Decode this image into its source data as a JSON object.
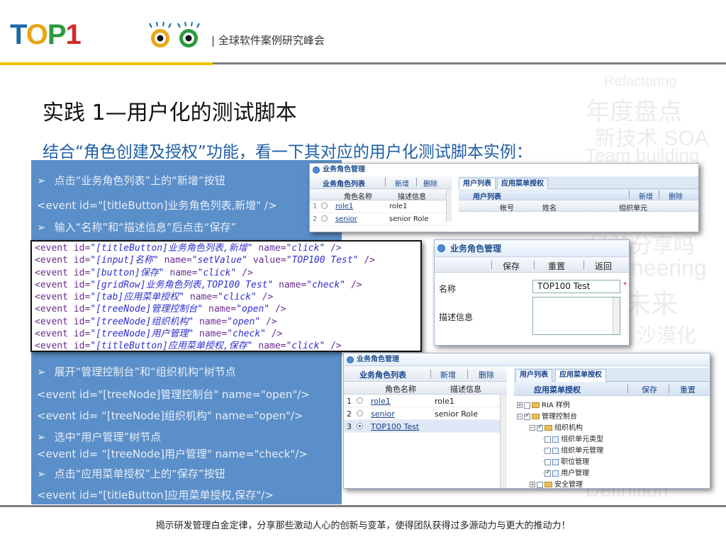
{
  "header": {
    "logo_text": [
      "T",
      "O",
      "P",
      "1"
    ],
    "subtitle": "| 全球软件案例研究峰会"
  },
  "watermark": {
    "lines": [
      "Refactoring",
      "年度盘点",
      "新技术 SOA",
      "Team building",
      "经验分享吗",
      "neering",
      "未来",
      "沙漠化",
      "Definition"
    ]
  },
  "title": "实践 1—用户化的测试脚本",
  "lead": "结合“角色创建及授权”功能，看一下其对应的用户化测试脚本实例：",
  "left_lines": {
    "l1": "点击“业务角色列表”上的“新增”按钮",
    "l2": "<event id=\"[titleButton]业务角色列表,新增\" />",
    "l3": "输入“名称”和“描述信息”后点击“保存”",
    "l4": "展开“管理控制台”和“组织机构”树节点",
    "l5": "<event id=\"[treeNode]管理控制台\" name=\"open\"/>",
    "l6": "<event id= “[treeNode]组织机构\" name=\"open\"/>",
    "l7": "选中“用户管理”树节点",
    "l8": "<event id= “[treeNode]用户管理\" name=\"check\"/>",
    "l9": "点击“应用菜单授权”上的“保存”按钮",
    "l10": "<event id=\"[titleButton]应用菜单授权,保存\"/>",
    "arrow": "➢"
  },
  "code_lines": [
    {
      "id": "\"[titleButton]业务角色列表,新增\"",
      "name": "\"click\"",
      "value": "",
      "tail": "/>"
    },
    {
      "id": "\"[input]名称\"",
      "name": "\"setValue\"",
      "value": "\"TOP100 Test\"",
      "tail": "/>"
    },
    {
      "id": "\"[button]保存\"",
      "name": "\"click\"",
      "value": "",
      "tail": "/>"
    },
    {
      "id": "\"[gridRow]业务角色列表,TOP100 Test\"",
      "name": "\"check\"",
      "value": "",
      "tail": "/>"
    },
    {
      "id": "\"[tab]应用菜单授权\"",
      "name": "\"click\"",
      "value": "",
      "tail": "/>"
    },
    {
      "id": "\"[treeNode]管理控制台\"",
      "name": "\"open\"",
      "value": "",
      "tail": "/>"
    },
    {
      "id": "\"[treeNode]组织机构\"",
      "name": "\"open\"",
      "value": "",
      "tail": "/>"
    },
    {
      "id": "\"[treeNode]用户管理\"",
      "name": "\"check\"",
      "value": "",
      "tail": "/>"
    },
    {
      "id": "\"[titleButton]应用菜单授权,保存\"",
      "name": "\"click\"",
      "value": "",
      "tail": "/>"
    }
  ],
  "code_tokens": {
    "event": "<event",
    "id": "id=",
    "name": "name=",
    "value": "value="
  },
  "panel1": {
    "title": "业务角色管理",
    "tab_left": "业务角色列表",
    "btn_add": "新增",
    "btn_del": "删除",
    "col_name": "角色名称",
    "col_desc": "描述信息",
    "rows": [
      {
        "idx": "1",
        "name": "role1",
        "desc": "role1"
      },
      {
        "idx": "2",
        "name": "senior",
        "desc": "senior Role"
      }
    ],
    "tab_users": "用户列表",
    "tab_menu": "应用菜单授权",
    "sub_title": "用户列表",
    "sub_add": "新增",
    "sub_del": "删除",
    "col_account": "帐号",
    "col_realname": "姓名",
    "col_org": "组织单元"
  },
  "panel2": {
    "title": "业务角色管理",
    "btn_save": "保存",
    "btn_reset": "重置",
    "btn_back": "返回",
    "label_name": "名称",
    "name_value": "TOP100 Test",
    "label_desc": "描述信息"
  },
  "panel3": {
    "title": "业务角色管理",
    "tab_left": "业务角色列表",
    "btn_add": "新增",
    "btn_del": "删除",
    "col_name": "角色名称",
    "col_desc": "描述信息",
    "rows": [
      {
        "idx": "1",
        "name": "role1",
        "desc": "role1"
      },
      {
        "idx": "2",
        "name": "senior",
        "desc": "senior Role"
      },
      {
        "idx": "3",
        "name": "TOP100 Test",
        "desc": ""
      }
    ],
    "tab_users": "用户列表",
    "tab_menu": "应用菜单授权",
    "menu_title": "应用菜单授权",
    "btn_save": "保存",
    "btn_reset": "重置",
    "tree": {
      "n1": "RIA 样例",
      "n2": "管理控制台",
      "n3": "组织机构",
      "n4": "组织单元类型",
      "n5": "组织单元管理",
      "n6": "职位管理",
      "n7": "用户管理",
      "n8": "安全管理"
    }
  },
  "footer": "揭示研发管理白金定律，分享那些激动人心的创新与变革，使得团队获得过多源动力与更大的推动力！",
  "colors": {
    "blue_block": "#5b8fc9",
    "yellow_bar": "#f2c200",
    "lead_blue": "#1f5fa6"
  }
}
